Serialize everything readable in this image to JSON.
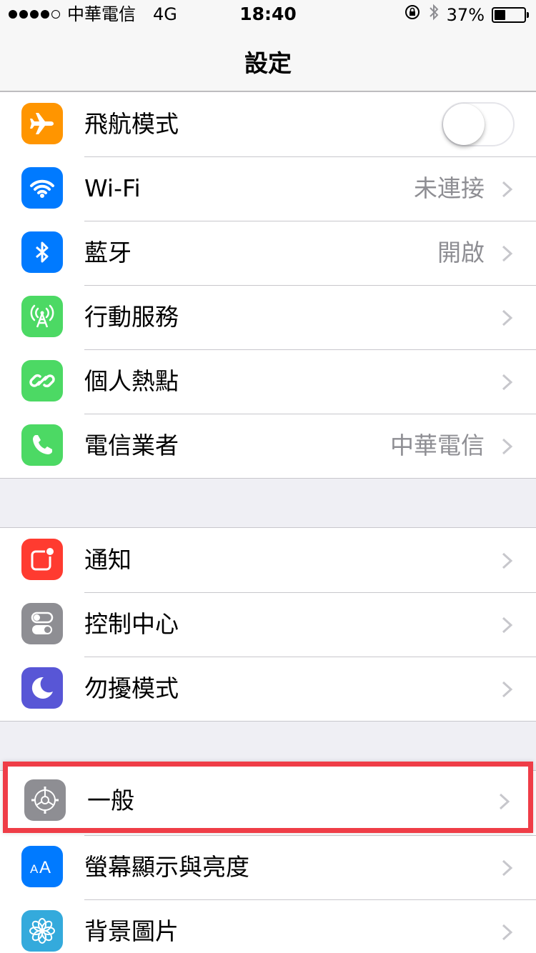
{
  "status_bar": {
    "carrier": "中華電信",
    "network": "4G",
    "time": "18:40",
    "battery": "37%",
    "battery_level": 0.37
  },
  "nav": {
    "title": "設定"
  },
  "groups": [
    {
      "rows": [
        {
          "label": "飛航模式",
          "icon": "airplane-icon",
          "color": "#ff9500",
          "toggle": false
        },
        {
          "label": "Wi-Fi",
          "value": "未連接",
          "icon": "wifi-icon",
          "color": "#007aff"
        },
        {
          "label": "藍牙",
          "value": "開啟",
          "icon": "bluetooth-icon",
          "color": "#007aff"
        },
        {
          "label": "行動服務",
          "icon": "cellular-icon",
          "color": "#4cd964"
        },
        {
          "label": "個人熱點",
          "icon": "hotspot-icon",
          "color": "#4cd964"
        },
        {
          "label": "電信業者",
          "value": "中華電信",
          "icon": "phone-icon",
          "color": "#4cd964"
        }
      ]
    },
    {
      "rows": [
        {
          "label": "通知",
          "icon": "notifications-icon",
          "color": "#ff3b30"
        },
        {
          "label": "控制中心",
          "icon": "control-center-icon",
          "color": "#8e8e93"
        },
        {
          "label": "勿擾模式",
          "icon": "moon-icon",
          "color": "#5856d6"
        }
      ]
    },
    {
      "rows": [
        {
          "label": "一般",
          "icon": "gear-icon",
          "color": "#8e8e93",
          "highlighted": true
        },
        {
          "label": "螢幕顯示與亮度",
          "icon": "display-icon",
          "color": "#007aff"
        },
        {
          "label": "背景圖片",
          "icon": "wallpaper-icon",
          "color": "#34aadc"
        }
      ]
    }
  ],
  "highlight_color": "#ef3d47"
}
